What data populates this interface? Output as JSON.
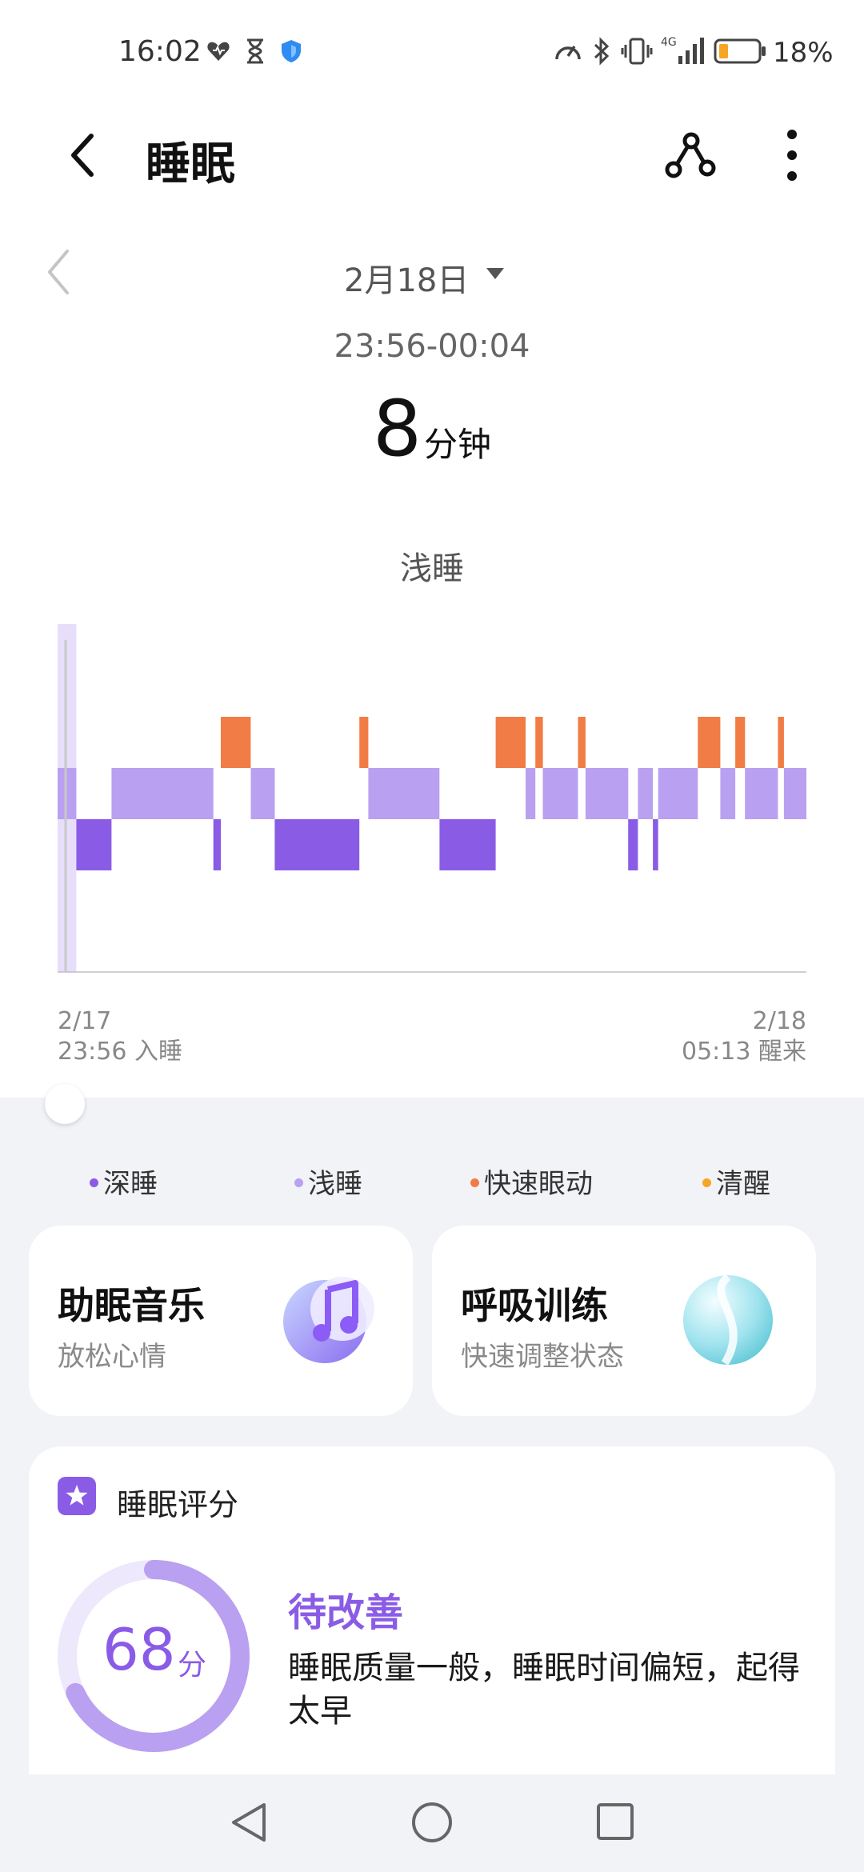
{
  "status_bar": {
    "time": "16:02",
    "battery_percent": "18%",
    "network": "4G"
  },
  "header": {
    "title": "睡眠",
    "back_icon": "back-arrow-icon",
    "share_icon": "share-icon",
    "more_icon": "more-vertical-icon"
  },
  "date_nav": {
    "date": "2月18日",
    "time_range": "23:56-00:04",
    "duration_value": "8",
    "duration_unit": "分钟",
    "selected_stage": "浅睡"
  },
  "chart_axis": {
    "start_date": "2/17",
    "start_time": "23:56 入睡",
    "end_date": "2/18",
    "end_time": "05:13 醒来"
  },
  "chart_data": {
    "type": "hypnogram",
    "time_range": [
      "23:56",
      "05:13"
    ],
    "stages": [
      "清醒",
      "快速眼动",
      "浅睡",
      "深睡"
    ],
    "colors": {
      "清醒": "#f5a623",
      "快速眼动": "#f27c45",
      "浅睡": "#b9a0f0",
      "深睡": "#8a5ce6"
    },
    "segments": [
      {
        "stage": "浅睡",
        "start": 0.0,
        "end": 0.025
      },
      {
        "stage": "深睡",
        "start": 0.025,
        "end": 0.072
      },
      {
        "stage": "浅睡",
        "start": 0.072,
        "end": 0.208
      },
      {
        "stage": "深睡",
        "start": 0.208,
        "end": 0.218
      },
      {
        "stage": "快速眼动",
        "start": 0.218,
        "end": 0.258
      },
      {
        "stage": "浅睡",
        "start": 0.258,
        "end": 0.29
      },
      {
        "stage": "深睡",
        "start": 0.29,
        "end": 0.403
      },
      {
        "stage": "快速眼动",
        "start": 0.403,
        "end": 0.415
      },
      {
        "stage": "浅睡",
        "start": 0.415,
        "end": 0.51
      },
      {
        "stage": "深睡",
        "start": 0.51,
        "end": 0.585
      },
      {
        "stage": "快速眼动",
        "start": 0.585,
        "end": 0.625
      },
      {
        "stage": "浅睡",
        "start": 0.625,
        "end": 0.638
      },
      {
        "stage": "快速眼动",
        "start": 0.638,
        "end": 0.648
      },
      {
        "stage": "浅睡",
        "start": 0.648,
        "end": 0.695
      },
      {
        "stage": "快速眼动",
        "start": 0.695,
        "end": 0.705
      },
      {
        "stage": "浅睡",
        "start": 0.705,
        "end": 0.762
      },
      {
        "stage": "深睡",
        "start": 0.762,
        "end": 0.775
      },
      {
        "stage": "浅睡",
        "start": 0.775,
        "end": 0.795
      },
      {
        "stage": "深睡",
        "start": 0.795,
        "end": 0.802
      },
      {
        "stage": "浅睡",
        "start": 0.802,
        "end": 0.855
      },
      {
        "stage": "快速眼动",
        "start": 0.855,
        "end": 0.885
      },
      {
        "stage": "浅睡",
        "start": 0.885,
        "end": 0.905
      },
      {
        "stage": "快速眼动",
        "start": 0.905,
        "end": 0.918
      },
      {
        "stage": "浅睡",
        "start": 0.918,
        "end": 0.962
      },
      {
        "stage": "快速眼动",
        "start": 0.962,
        "end": 0.97
      },
      {
        "stage": "浅睡",
        "start": 0.97,
        "end": 1.0
      }
    ],
    "selected_segment": {
      "stage": "浅睡",
      "start": 0.0,
      "end": 0.025
    }
  },
  "legend": [
    {
      "label": "深睡",
      "color": "#8a5ce6"
    },
    {
      "label": "浅睡",
      "color": "#b9a0f0"
    },
    {
      "label": "快速眼动",
      "color": "#f27c45"
    },
    {
      "label": "清醒",
      "color": "#f5a623"
    }
  ],
  "cards": {
    "music": {
      "title": "助眠音乐",
      "subtitle": "放松心情",
      "icon": "music-moon-icon"
    },
    "breath": {
      "title": "呼吸训练",
      "subtitle": "快速调整状态",
      "icon": "breathing-orb-icon"
    }
  },
  "score_card": {
    "title": "睡眠评分",
    "score": "68",
    "score_unit": "分",
    "score_fraction": 0.68,
    "status": "待改善",
    "description": "睡眠质量一般，睡眠时间偏短，起得太早"
  },
  "nav": {
    "back": "nav-back-icon",
    "home": "nav-home-icon",
    "recents": "nav-recents-icon"
  }
}
